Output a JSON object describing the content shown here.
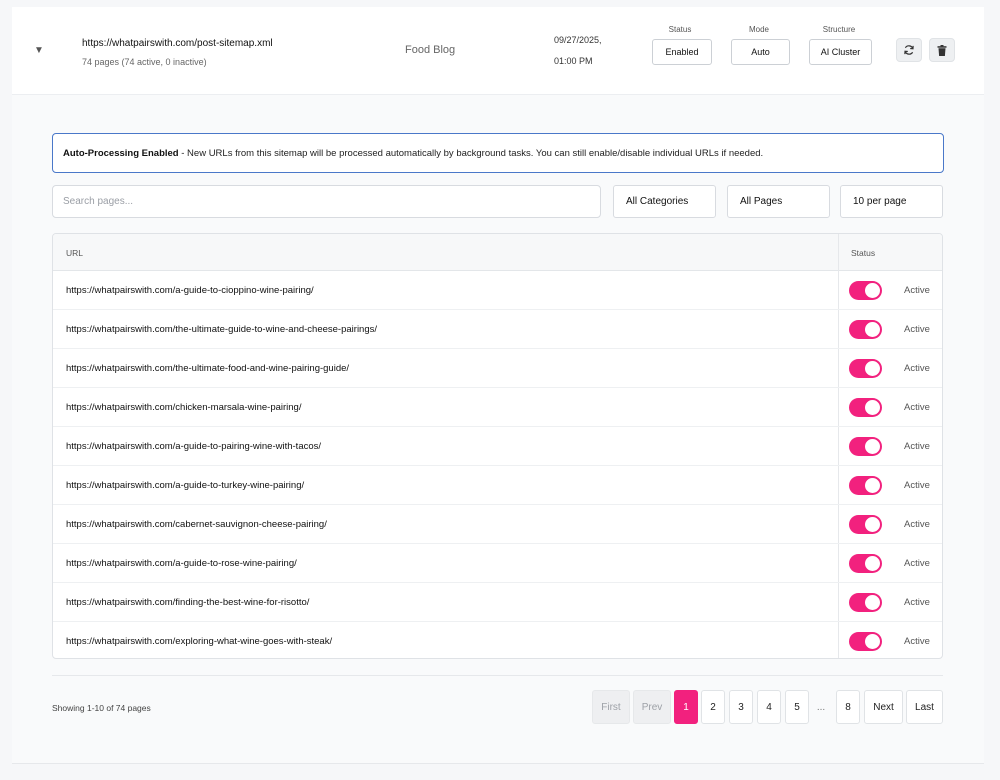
{
  "sitemap": {
    "expand_icon": "▼",
    "url": "https://whatpairswith.com/post-sitemap.xml",
    "meta": "74 pages (74 active, 0 inactive)",
    "category": "Food Blog",
    "date": "09/27/2025,",
    "time": "01:00 PM",
    "status_label": "Status",
    "status_value": "Enabled",
    "mode_label": "Mode",
    "mode_value": "Auto",
    "structure_label": "Structure",
    "structure_value": "AI Cluster",
    "refresh_icon": "refresh-icon",
    "delete_icon": "trash-icon"
  },
  "notice": {
    "title": "Auto-Processing Enabled",
    "text": " - New URLs from this sitemap will be processed automatically by background tasks. You can still enable/disable individual URLs if needed."
  },
  "filters": {
    "search_placeholder": "Search pages...",
    "category": "All Categories",
    "pages": "All Pages",
    "per_page": "10 per page"
  },
  "table": {
    "col_url": "URL",
    "col_status": "Status",
    "rows": [
      {
        "url": "https://whatpairswith.com/a-guide-to-cioppino-wine-pairing/",
        "status": "Active"
      },
      {
        "url": "https://whatpairswith.com/the-ultimate-guide-to-wine-and-cheese-pairings/",
        "status": "Active"
      },
      {
        "url": "https://whatpairswith.com/the-ultimate-food-and-wine-pairing-guide/",
        "status": "Active"
      },
      {
        "url": "https://whatpairswith.com/chicken-marsala-wine-pairing/",
        "status": "Active"
      },
      {
        "url": "https://whatpairswith.com/a-guide-to-pairing-wine-with-tacos/",
        "status": "Active"
      },
      {
        "url": "https://whatpairswith.com/a-guide-to-turkey-wine-pairing/",
        "status": "Active"
      },
      {
        "url": "https://whatpairswith.com/cabernet-sauvignon-cheese-pairing/",
        "status": "Active"
      },
      {
        "url": "https://whatpairswith.com/a-guide-to-rose-wine-pairing/",
        "status": "Active"
      },
      {
        "url": "https://whatpairswith.com/finding-the-best-wine-for-risotto/",
        "status": "Active"
      },
      {
        "url": "https://whatpairswith.com/exploring-what-wine-goes-with-steak/",
        "status": "Active"
      }
    ]
  },
  "pagination": {
    "showing": "Showing 1-10 of 74 pages",
    "first": "First",
    "prev": "Prev",
    "pages": [
      "1",
      "2",
      "3",
      "4",
      "5"
    ],
    "ellipsis": "...",
    "last_page": "8",
    "next": "Next",
    "last": "Last"
  },
  "colors": {
    "accent": "#f2217e",
    "notice_border": "#4a78c9"
  }
}
